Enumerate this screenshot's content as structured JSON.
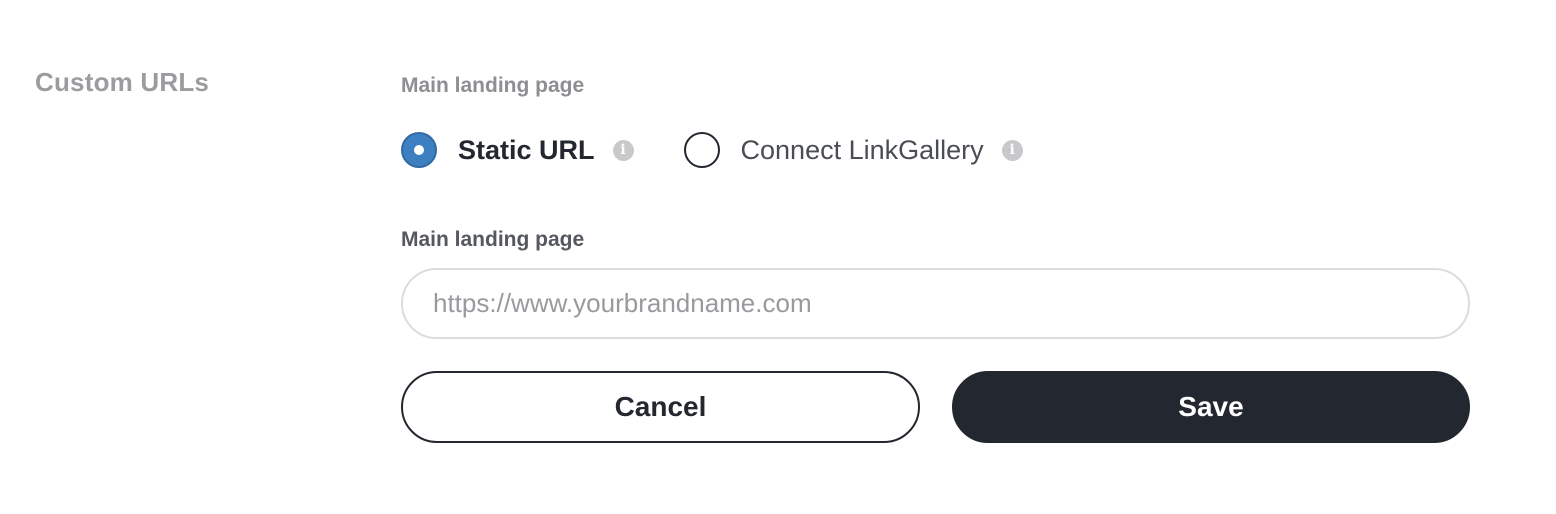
{
  "section": {
    "title": "Custom URLs"
  },
  "landing_type": {
    "label": "Main landing page",
    "options": [
      {
        "label": "Static URL",
        "selected": true,
        "info_icon": "info-icon"
      },
      {
        "label": "Connect LinkGallery",
        "selected": false,
        "info_icon": "info-icon"
      }
    ]
  },
  "url_field": {
    "label": "Main landing page",
    "value": "",
    "placeholder": "https://www.yourbrandname.com"
  },
  "actions": {
    "cancel_label": "Cancel",
    "save_label": "Save"
  },
  "colors": {
    "accent": "#3d7fc0",
    "primary_button": "#232730",
    "muted_text": "#9c9ca0"
  }
}
